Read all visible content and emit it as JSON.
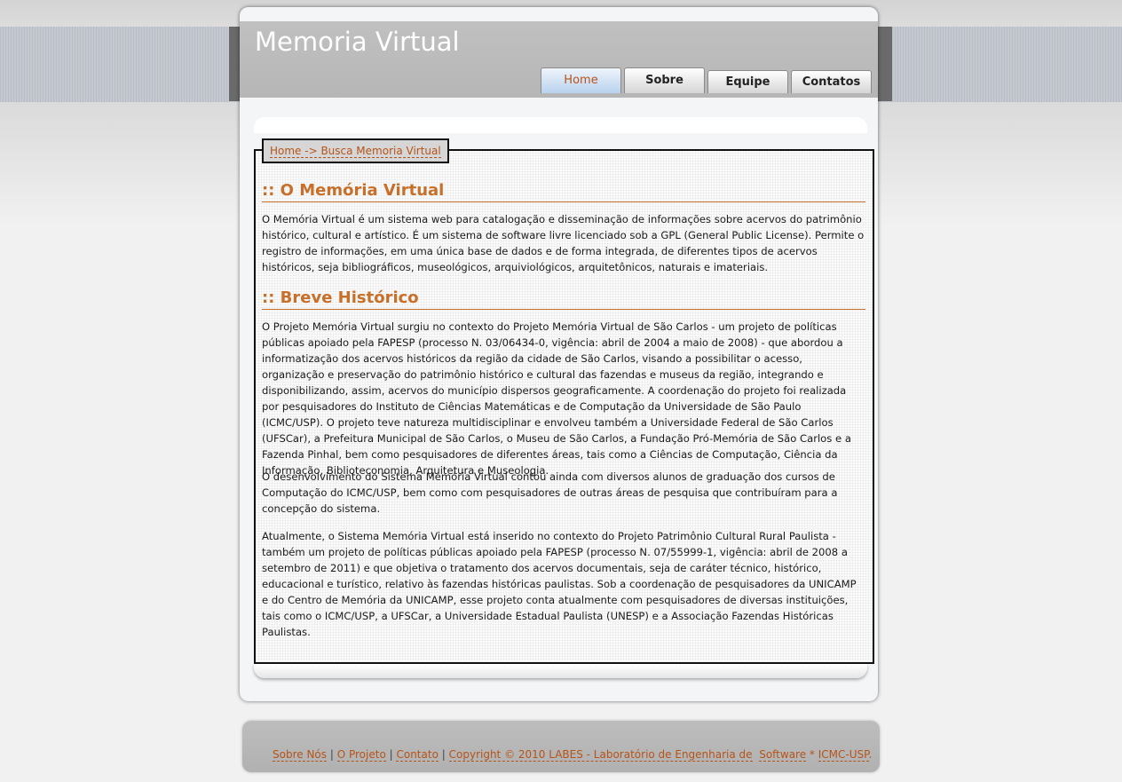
{
  "site": {
    "title": "Memoria Virtual"
  },
  "nav": {
    "tabs": [
      {
        "label": "Home",
        "active": true
      },
      {
        "label": "Sobre",
        "active": false
      },
      {
        "label": "Equipe",
        "active": false
      },
      {
        "label": "Contatos",
        "active": false
      }
    ]
  },
  "breadcrumb": "Home -> Busca Memoria Virtual",
  "sections": [
    {
      "title": ":: O Memória Virtual",
      "paragraphs": [
        " O Memória Virtual é um sistema web para catalogação e disseminação de informações sobre acervos do patrimônio histórico, cultural e artístico. É um sistema de software livre licenciado sob a GPL (General Public License). Permite o registro de informações, em uma única base de dados e de forma integrada, de diferentes tipos de acervos históricos, seja bibliográficos, museológicos, arquiviológicos, arquitetônicos, naturais e imateriais."
      ]
    },
    {
      "title": ":: Breve Histórico",
      "paragraphs": [
        "O Projeto Memória Virtual surgiu no contexto do Projeto Memória Virtual de São Carlos - um projeto de políticas públicas apoiado pela FAPESP (processo N. 03/06434-0, vigência: abril de 2004 a maio de 2008) - que abordou a informatização dos acervos históricos da região da cidade de São Carlos, visando a possibilitar o acesso, organização e preservação do patrimônio histórico e cultural das fazendas e museus da região, integrando e disponibilizando, assim, acervos do município dispersos geograficamente. A coordenação do projeto foi realizada por pesquisadores do Instituto de Ciências Matemáticas e de Computação da Universidade de São Paulo (ICMC/USP). O projeto teve natureza multidisciplinar e envolveu também a Universidade Federal de São Carlos (UFSCar), a Prefeitura Municipal de São Carlos, o Museu de São Carlos, a Fundação Pró-Memória de São Carlos e a Fazenda Pinhal, bem como pesquisadores de diferentes áreas, tais como a Ciências de Computação, Ciência da Informação, Biblioteconomia, Arquitetura e Museologia.",
        "O desenvolvimento do Sistema Memória Virtual contou ainda com diversos alunos de graduação dos cursos de Computação do ICMC/USP, bem como com pesquisadores de outras áreas de pesquisa que contribuíram para a concepção do sistema.",
        "Atualmente, o Sistema Memória Virtual está inserido no contexto do Projeto Patrimônio Cultural Rural Paulista - também um projeto de políticas públicas apoiado pela FAPESP (processo N. 07/55999-1, vigência: abril de 2008 a setembro de 2011) e que objetiva o tratamento dos acervos documentais, seja de caráter técnico, histórico, educacional e turístico, relativo às fazendas históricas paulistas. Sob a coordenação de pesquisadores da UNICAMP e do Centro de Memória da UNICAMP, esse projeto conta atualmente com pesquisadores de diversas instituições, tais como o ICMC/USP, a UFSCar, a Universidade Estadual Paulista (UNESP) e a Associação Fazendas Históricas Paulistas."
      ]
    }
  ],
  "footer": {
    "links": [
      "Sobre Nós",
      "O Projeto",
      "Contato"
    ],
    "separator": "|",
    "copyright": "Copyright © 2010 LABES - Laboratório de Engenharia de",
    "software": "Software",
    "star": " * ",
    "icmc": "ICMC-USP",
    "end": "."
  },
  "colors": {
    "link": "#b5541a",
    "heading": "#c8702a",
    "header_bg": "#b6b6b6"
  }
}
